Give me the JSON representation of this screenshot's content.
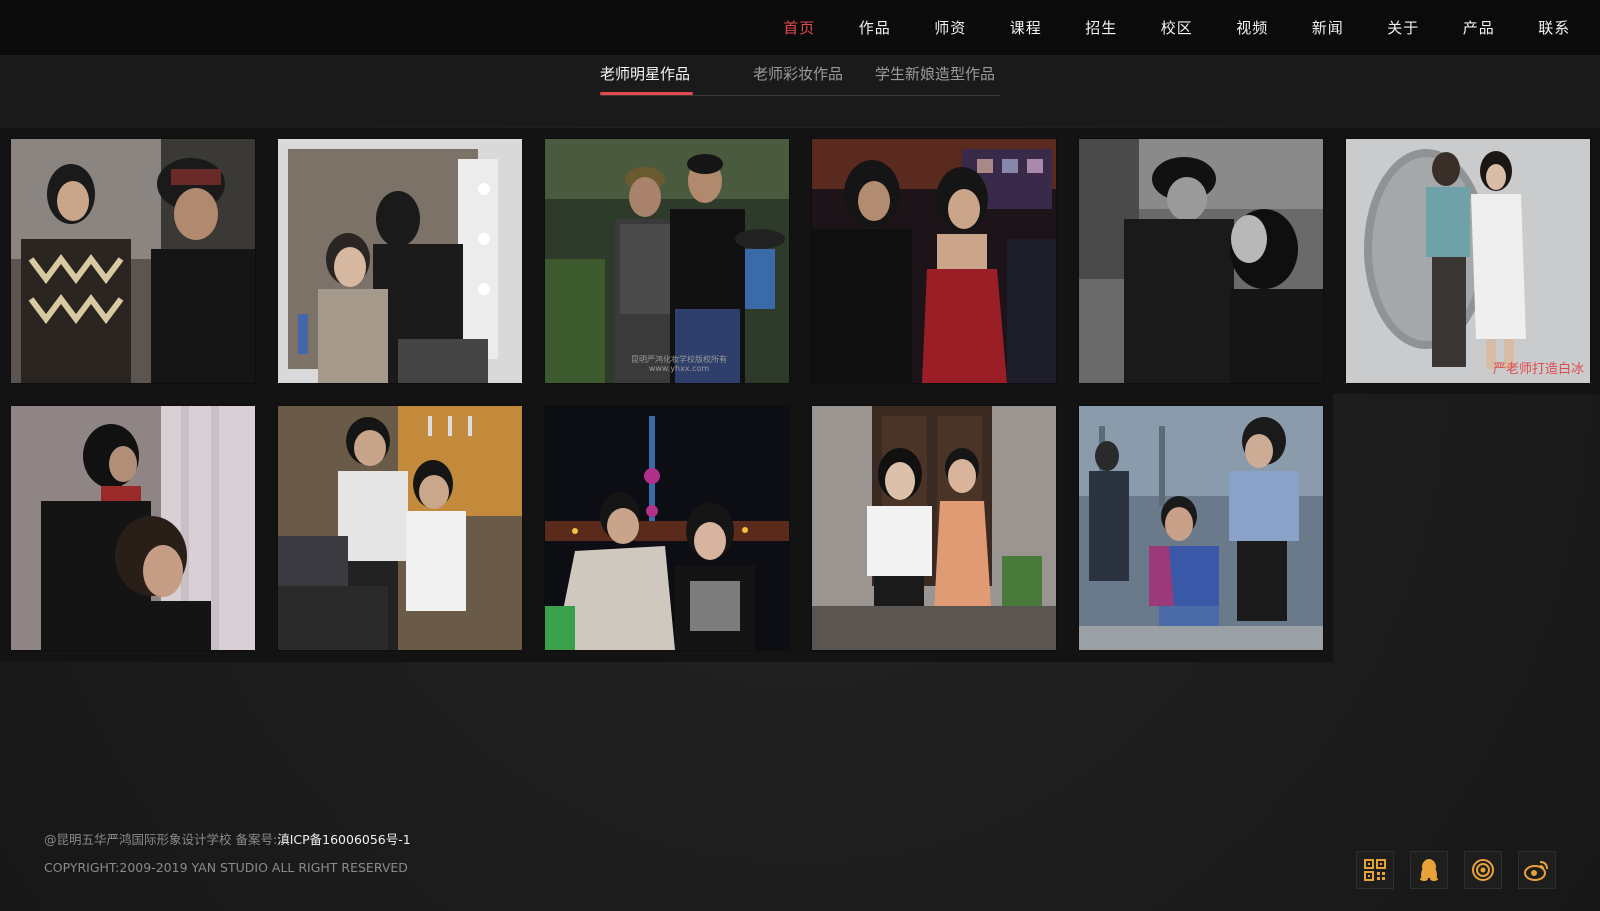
{
  "nav": {
    "items": [
      {
        "label": "首页",
        "active": true
      },
      {
        "label": "作品"
      },
      {
        "label": "师资"
      },
      {
        "label": "课程"
      },
      {
        "label": "招生"
      },
      {
        "label": "校区"
      },
      {
        "label": "视频"
      },
      {
        "label": "新闻"
      },
      {
        "label": "关于"
      },
      {
        "label": "产品"
      },
      {
        "label": "联系"
      }
    ]
  },
  "tabs": [
    {
      "label": "老师明星作品",
      "active": true
    },
    {
      "label": "老师彩妆作品"
    },
    {
      "label": "学生新娘造型作品"
    }
  ],
  "gallery": {
    "photos": [
      {
        "name": "photo-makeup-artist-star-1"
      },
      {
        "name": "photo-mirror-makeup"
      },
      {
        "name": "photo-outdoor-two-men",
        "watermark": "昆明严鸿化妆学校版权所有 www.yhxx.com"
      },
      {
        "name": "photo-red-dress-event"
      },
      {
        "name": "photo-bw-eye-makeup"
      },
      {
        "name": "photo-studio-bai-bing",
        "caption": "严老师打造白冰"
      },
      {
        "name": "photo-hair-styling"
      },
      {
        "name": "photo-backstage-glasses"
      },
      {
        "name": "photo-night-city"
      },
      {
        "name": "photo-two-women-thumbs"
      },
      {
        "name": "photo-street-set"
      }
    ]
  },
  "footer": {
    "line1_prefix": "@昆明五华严鸿国际形象设计学校 备案号:",
    "icp": "滇ICP备16006056号-1",
    "copyright": "COPYRIGHT:2009-2019 YAN STUDIO ALL RIGHT RESERVED"
  },
  "social": [
    {
      "icon": "qrcode-icon"
    },
    {
      "icon": "qq-icon"
    },
    {
      "icon": "target-icon"
    },
    {
      "icon": "weibo-icon"
    }
  ],
  "colors": {
    "accent": "#e5484d",
    "social": "#e8a23a"
  }
}
